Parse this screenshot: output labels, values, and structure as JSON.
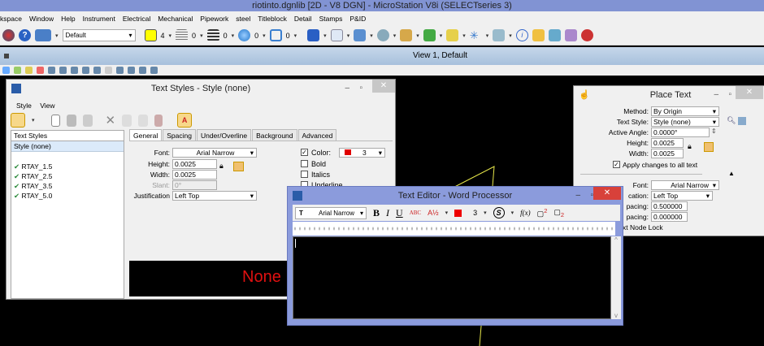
{
  "app": {
    "title": "riotinto.dgnlib [2D - V8 DGN] - MicroStation V8i (SELECTseries 3)"
  },
  "menu": [
    "kspace",
    "Window",
    "Help",
    "Instrument",
    "Electrical",
    "Mechanical",
    "Pipework",
    "steel",
    "Titleblock",
    "Detail",
    "Stamps",
    "P&ID"
  ],
  "toolbar": {
    "level": "Default",
    "color": "4",
    "style": "0",
    "weight": "0",
    "transparency": "0",
    "priority": "0",
    "color_hex": "#ffff00"
  },
  "view": {
    "title": "View 1, Default"
  },
  "text_styles": {
    "title": "Text Styles - Style (none)",
    "menu": [
      "Style",
      "View"
    ],
    "list_header": "Text Styles",
    "selected": "Style (none)",
    "styles": [
      "RTAY_1.5",
      "RTAY_2.5",
      "RTAY_3.5",
      "RTAY_5.0"
    ],
    "tabs": [
      "General",
      "Spacing",
      "Under/Overline",
      "Background",
      "Advanced"
    ],
    "font_label": "Font:",
    "font": "Arial Narrow",
    "height_label": "Height:",
    "height": "0.0025",
    "width_label": "Width:",
    "width": "0.0025",
    "slant_label": "Slant:",
    "slant": "0°",
    "just_label": "Justification",
    "justification": "Left Top",
    "color_label": "Color:",
    "color": "3",
    "color_hex": "#e00000",
    "bold": "Bold",
    "italics": "Italics",
    "underline": "Underline",
    "preview": "None"
  },
  "place_text": {
    "title": "Place Text",
    "method_label": "Method:",
    "method": "By Origin",
    "style_label": "Text Style:",
    "style": "Style (none)",
    "angle_label": "Active Angle:",
    "angle": "0.0000°",
    "height_label": "Height:",
    "height": "0.0025",
    "width_label": "Width:",
    "width": "0.0025",
    "apply": "Apply changes to all text",
    "font_label": "Font:",
    "font": "Arial Narrow",
    "just_label": "cation:",
    "justification": "Left Top",
    "ls_label": "pacing:",
    "line_spacing": "0.500000",
    "is_label": "pacing:",
    "interchar_spacing": "0.000000",
    "node_lock": "xt Node Lock"
  },
  "editor": {
    "title": "Text Editor - Word Processor",
    "font": "Arial Narrow",
    "bold": "B",
    "italic": "I",
    "underline": "U",
    "spell": "ABC",
    "color": "3",
    "fx": "f(x)"
  }
}
